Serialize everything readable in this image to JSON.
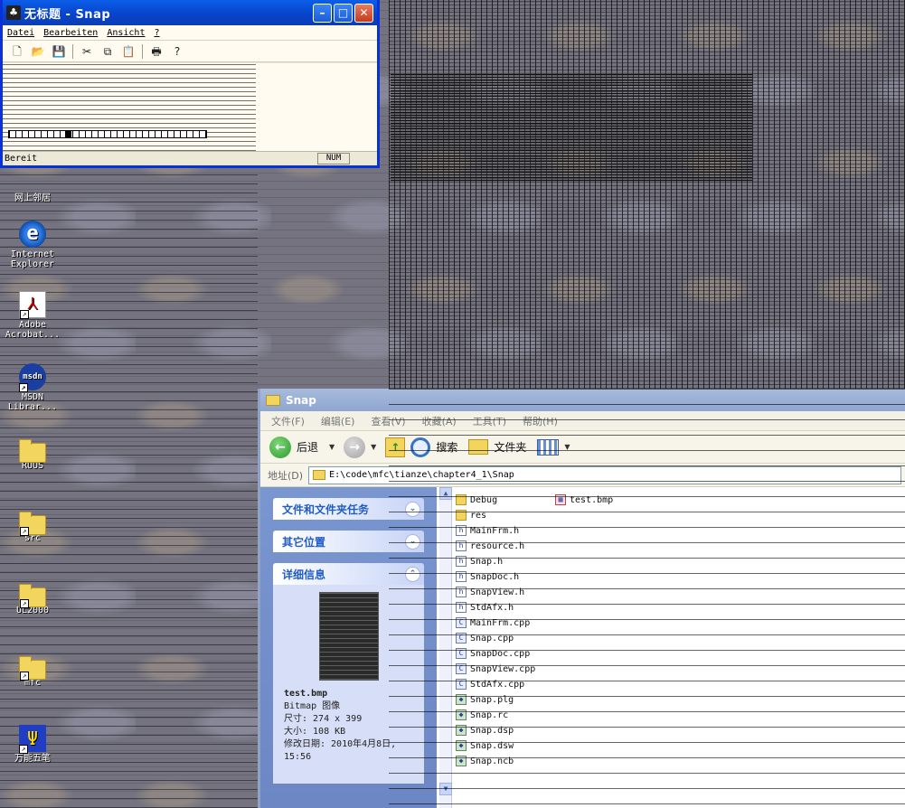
{
  "snap_window": {
    "title": "无标题 - Snap",
    "menu": [
      "Datei",
      "Bearbeiten",
      "Ansicht",
      "?"
    ],
    "toolbar_icons": [
      "new-icon",
      "open-icon",
      "save-icon",
      "cut-icon",
      "copy-icon",
      "paste-icon",
      "print-icon",
      "help-icon"
    ],
    "status_text": "Bereit",
    "status_pane": "NUM"
  },
  "desktop_icons": [
    {
      "label": "网上邻居",
      "icon": "network-icon"
    },
    {
      "label": "Internet Explorer",
      "icon": "ie-icon"
    },
    {
      "label": "Adobe Acrobat...",
      "icon": "acrobat-icon"
    },
    {
      "label": "MSDN Librar...",
      "icon": "msdn-icon"
    },
    {
      "label": "RUUS",
      "icon": "folder-icon"
    },
    {
      "label": "src",
      "icon": "folder-icon"
    },
    {
      "label": "UL2000",
      "icon": "folder-icon"
    },
    {
      "label": "mfc",
      "icon": "folder-icon"
    },
    {
      "label": "万能五笔",
      "icon": "wanneng-icon"
    }
  ],
  "explorer": {
    "title": "Snap",
    "menu": [
      "文件(F)",
      "编辑(E)",
      "查看(V)",
      "收藏(A)",
      "工具(T)",
      "帮助(H)"
    ],
    "toolbar": {
      "back": "后退",
      "search": "搜索",
      "folders": "文件夹"
    },
    "address_label": "地址(D)",
    "address_value": "E:\\code\\mfc\\tianze\\chapter4_1\\Snap",
    "panels": [
      "文件和文件夹任务",
      "其它位置",
      "详细信息"
    ],
    "details": {
      "name": "test.bmp",
      "type": "Bitmap 图像",
      "dimensions": "尺寸: 274 x 399",
      "size": "大小: 108 KB",
      "modified": "修改日期: 2010年4月8日, 15:56"
    },
    "files": [
      {
        "name": "Debug",
        "type": "folder"
      },
      {
        "name": "res",
        "type": "folder"
      },
      {
        "name": "MainFrm.h",
        "type": "h"
      },
      {
        "name": "resource.h",
        "type": "h"
      },
      {
        "name": "Snap.h",
        "type": "h"
      },
      {
        "name": "SnapDoc.h",
        "type": "h"
      },
      {
        "name": "SnapView.h",
        "type": "h"
      },
      {
        "name": "StdAfx.h",
        "type": "h"
      },
      {
        "name": "MainFrm.cpp",
        "type": "cpp"
      },
      {
        "name": "Snap.cpp",
        "type": "cpp"
      },
      {
        "name": "SnapDoc.cpp",
        "type": "cpp"
      },
      {
        "name": "SnapView.cpp",
        "type": "cpp"
      },
      {
        "name": "StdAfx.cpp",
        "type": "cpp"
      },
      {
        "name": "Snap.plg",
        "type": "misc"
      },
      {
        "name": "Snap.rc",
        "type": "misc"
      },
      {
        "name": "Snap.dsp",
        "type": "misc"
      },
      {
        "name": "Snap.dsw",
        "type": "misc"
      },
      {
        "name": "Snap.ncb",
        "type": "misc"
      }
    ],
    "files_col2": [
      {
        "name": "test.bmp",
        "type": "bmp"
      }
    ]
  }
}
